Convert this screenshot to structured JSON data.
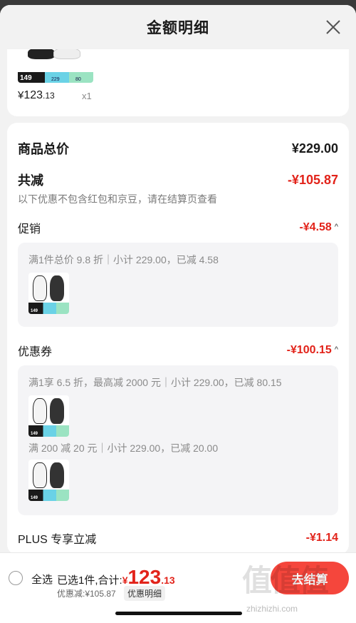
{
  "header": {
    "title": "金额明细"
  },
  "product": {
    "price_prefix": "¥",
    "price_int": "123",
    "price_dec": ".13",
    "qty": "x1",
    "thumb_price": "149",
    "thumb_n1": "229",
    "thumb_n2": "80"
  },
  "breakdown": {
    "total_label": "商品总价",
    "total_value": "¥229.00",
    "reduce_label": "共减",
    "reduce_value": "-¥105.87",
    "reduce_note": "以下优惠不包含红包和京豆，请在结算页查看",
    "promo_label": "促销",
    "promo_value": "-¥4.58",
    "promo_desc": "满1件总价 9.8 折｜小计 229.00，已减 4.58",
    "coupon_label": "优惠券",
    "coupon_value": "-¥100.15",
    "coupon_desc1": "满1享 6.5 折，最高减 2000 元｜小计 229.00，已减 80.15",
    "coupon_desc2": "满 200 减 20 元｜小计 229.00，已减 20.00",
    "plus_label": "PLUS 专享立减",
    "plus_value": "-¥1.14"
  },
  "footer": {
    "select_all": "全选",
    "summary_prefix": "已选1件,合计:",
    "currency": "¥",
    "amount_int": "123",
    "amount_dec": ".13",
    "discount_text": "优惠减:¥105.87",
    "detail_badge": "优惠明细",
    "checkout_label": "去结算"
  },
  "watermark": {
    "logo": "值值值",
    "url": "zhizhizhi.com"
  },
  "colors": {
    "accent": "#e2231a",
    "checkout": "#f5463c"
  }
}
